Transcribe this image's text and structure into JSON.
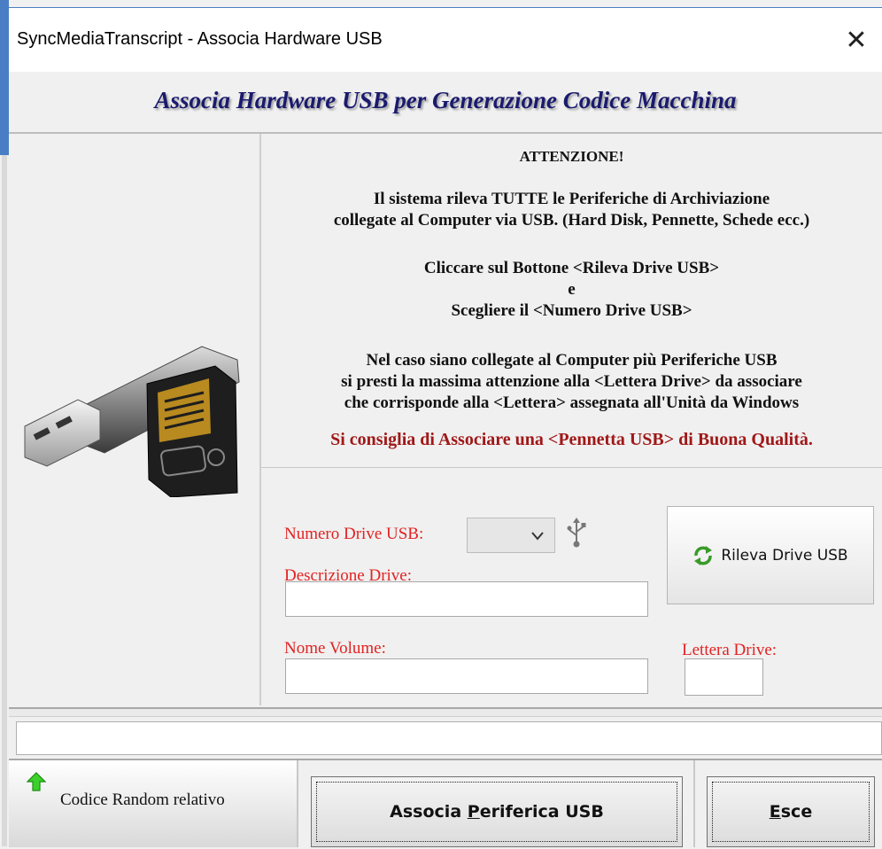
{
  "window": {
    "title": "SyncMediaTranscript - Associa Hardware USB",
    "close_glyph": "✕"
  },
  "header": {
    "title": "Associa Hardware USB per Generazione Codice Macchina"
  },
  "info": {
    "attention": "ATTENZIONE!",
    "para1_line1": "Il sistema rileva TUTTE le Periferiche di Archiviazione",
    "para1_line2": "collegate al Computer via USB. (Hard Disk, Pennette, Schede ecc.)",
    "para2_line1": "Cliccare sul Bottone <Rileva Drive USB>",
    "para2_line2": "e",
    "para2_line3": "Scegliere il <Numero Drive USB>",
    "para3_line1": "Nel caso siano collegate al Computer più Periferiche USB",
    "para3_line2": "si presti la massima attenzione alla <Lettera Drive> da associare",
    "para3_line3": "che corrisponde alla <Lettera> assegnata all'Unità da Windows",
    "warning": "Si consiglia di Associare una <Pennetta USB> di Buona Qualità."
  },
  "form": {
    "numero_drive_label": "Numero Drive USB:",
    "numero_drive_value": "",
    "descrizione_label": "Descrizione Drive:",
    "descrizione_value": "",
    "nome_volume_label": "Nome Volume:",
    "nome_volume_value": "",
    "lettera_drive_label": "Lettera Drive:",
    "lettera_drive_value": "",
    "rileva_button": "Rileva Drive USB"
  },
  "status": {
    "text": ""
  },
  "bottom": {
    "codice_label": "Codice Random relativo",
    "associa_button_pre": "Associa ",
    "associa_button_mnemonic": "P",
    "associa_button_post": "eriferica USB",
    "esce_button_mnemonic": "E",
    "esce_button_post": "sce"
  },
  "icons": {
    "usb_device": "usb-drive-and-sd-card-icon",
    "usb_symbol": "usb-symbol-icon",
    "refresh": "refresh-icon",
    "arrow_up": "green-arrow-up-icon"
  },
  "colors": {
    "accent": "#4a7ec4",
    "header_text": "#1a1a6e",
    "label_red": "#e32222",
    "warning_red": "#a01818"
  }
}
